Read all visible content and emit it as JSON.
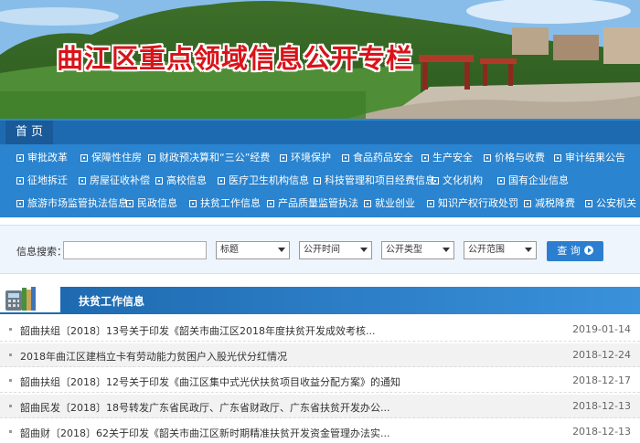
{
  "banner": {
    "title": "曲江区重点领域信息公开专栏"
  },
  "nav": {
    "home": "首 页"
  },
  "categories": {
    "row1": [
      "审批改革",
      "保障性住房",
      "财政预决算和“三公”经费",
      "环境保护",
      "食品药品安全",
      "生产安全",
      "价格与收费",
      "审计结果公告"
    ],
    "row2": [
      "征地拆迁",
      "房屋征收补偿",
      "高校信息",
      "医疗卫生机构信息",
      "科技管理和项目经费信息",
      "文化机构",
      "国有企业信息"
    ],
    "row3": [
      "旅游市场监管执法信息",
      "民政信息",
      "扶贫工作信息",
      "产品质量监管执法",
      "就业创业",
      "知识产权行政处罚",
      "减税降费",
      "公安机关"
    ]
  },
  "search": {
    "label": "信息搜索：",
    "input_value": "",
    "selects": [
      "标题",
      "公开时间",
      "公开类型",
      "公开范围"
    ],
    "button": "查 询"
  },
  "section": {
    "title": "扶贫工作信息"
  },
  "news": [
    {
      "title": "韶曲扶组〔2018〕13号关于印发《韶关市曲江区2018年度扶贫开发成效考核...",
      "date": "2019-01-14"
    },
    {
      "title": "2018年曲江区建档立卡有劳动能力贫困户入股光伏分红情况",
      "date": "2018-12-24"
    },
    {
      "title": "韶曲扶组〔2018〕12号关于印发《曲江区集中式光伏扶贫项目收益分配方案》的通知",
      "date": "2018-12-17"
    },
    {
      "title": "韶曲民发〔2018〕18号转发广东省民政厅、广东省财政厅、广东省扶贫开发办公...",
      "date": "2018-12-13"
    },
    {
      "title": "韶曲财〔2018〕62关于印发《韶关市曲江区新时期精准扶贫开发资金管理办法实...",
      "date": "2018-12-13"
    }
  ]
}
